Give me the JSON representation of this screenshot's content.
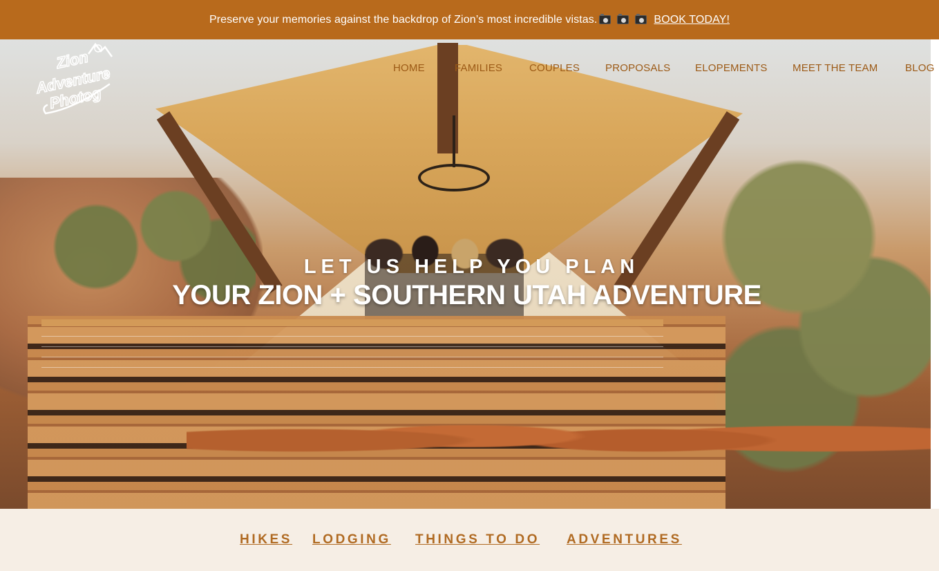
{
  "announcement": {
    "text": "Preserve your memories against the backdrop of Zion’s most incredible vistas.",
    "camera_icon": "camera-with-flash-icon",
    "cta": "BOOK TODAY!"
  },
  "logo": {
    "line1": "Zion",
    "line2": "Adventure",
    "line3": "Photog"
  },
  "nav": {
    "items": [
      "HOME",
      "FAMILIES",
      "COUPLES",
      "PROPOSALS",
      "ELOPEMENTS",
      "MEET THE TEAM",
      "BLOG"
    ]
  },
  "hero": {
    "subtitle": "LET US HELP YOU PLAN",
    "title": "YOUR ZION + SOUTHERN UTAH ADVENTURE"
  },
  "links": {
    "items": [
      "HIKES",
      "LODGING",
      "THINGS TO DO",
      "ADVENTURES"
    ]
  },
  "colors": {
    "brand_orange": "#b86a1c",
    "nav_text": "#9c5a16",
    "link_text": "#b06a22",
    "strip_bg": "#f6eee5"
  }
}
